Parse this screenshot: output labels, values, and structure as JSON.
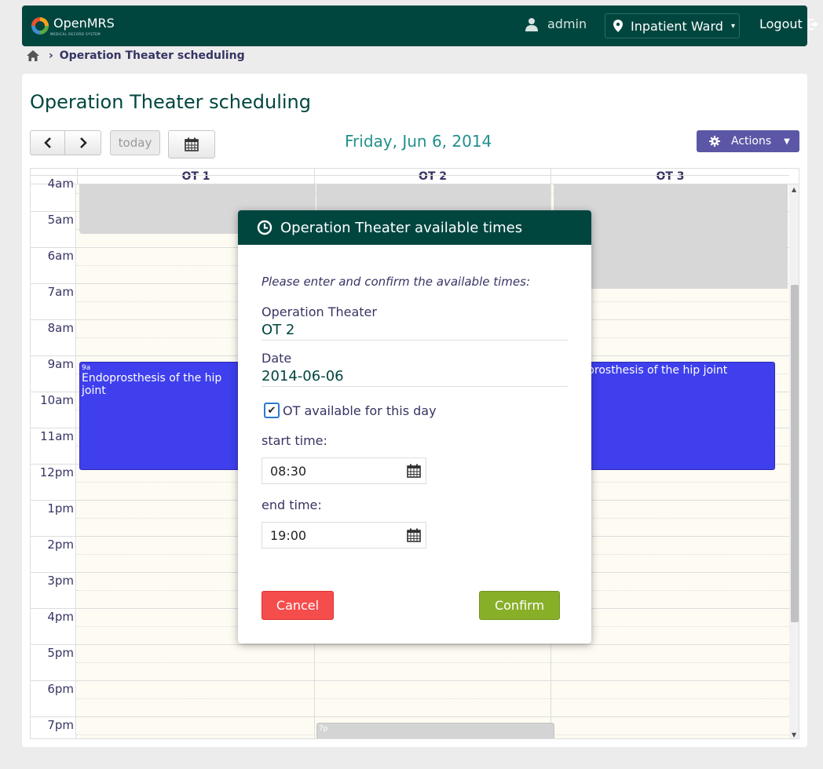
{
  "header": {
    "logo_text": "OpenMRS",
    "logo_sub": "MEDICAL RECORD SYSTEM",
    "user": "admin",
    "location": "Inpatient Ward",
    "logout": "Logout"
  },
  "breadcrumb": {
    "current": "Operation Theater scheduling"
  },
  "page": {
    "title": "Operation Theater scheduling"
  },
  "toolbar": {
    "today": "today",
    "date_title": "Friday, Jun 6, 2014",
    "actions": "Actions"
  },
  "calendar": {
    "columns": [
      "OT 1",
      "OT 2",
      "OT 3"
    ],
    "times": [
      "4am",
      "5am",
      "6am",
      "7am",
      "8am",
      "9am",
      "10am",
      "11am",
      "12pm",
      "1pm",
      "2pm",
      "3pm",
      "4pm",
      "5pm",
      "6pm",
      "7pm"
    ],
    "events": [
      {
        "time": "9a",
        "title": "Endoprosthesis of the hip joint"
      },
      {
        "time": "",
        "title": "prosthesis of the hip joint"
      },
      {
        "time": "7p",
        "title": ""
      }
    ]
  },
  "modal": {
    "title": "Operation Theater available times",
    "instruction": "Please enter and confirm the available times:",
    "ot_label": "Operation Theater",
    "ot_value": "OT 2",
    "date_label": "Date",
    "date_value": "2014-06-06",
    "available_label": "OT available for this day",
    "available_checked": true,
    "start_label": "start time:",
    "start_value": "08:30",
    "end_label": "end time:",
    "end_value": "19:00",
    "cancel": "Cancel",
    "confirm": "Confirm"
  },
  "colors": {
    "header": "#00463f",
    "accent": "#21908d",
    "actions": "#5b57a6",
    "event": "#3f3fee",
    "cancel": "#f54c4c",
    "confirm": "#88af28"
  }
}
